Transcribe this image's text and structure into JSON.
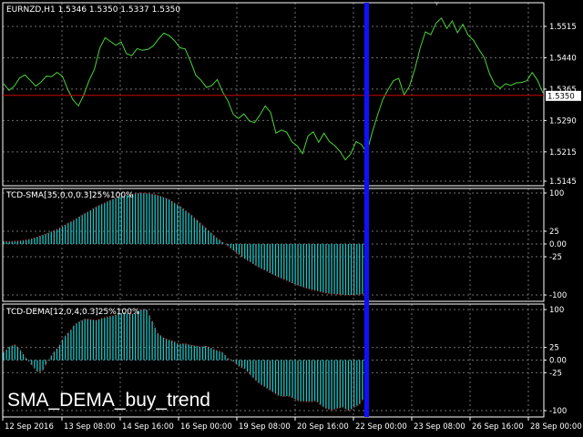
{
  "colors": {
    "background": "#000000",
    "frame": "#ffffff",
    "grid": "#6f6f6f",
    "price_line": "#4bd23a",
    "bid_line": "#c80000",
    "bid_label_bg": "#ffffff",
    "oscillator": "#1fc3c3",
    "signal_dotted": "#d01818",
    "cursor_line": "#1010ff"
  },
  "main": {
    "title": "EURNZD,H1  1.5346 1.5350 1.5337 1.5350",
    "price_labels": [
      "1.5515",
      "1.5440",
      "1.5365",
      "1.5290",
      "1.5215",
      "1.5145"
    ],
    "bid_label": "1.5350",
    "bid_value": 1.535
  },
  "sub1": {
    "title": "TCD-SMA[35,0,0,0.3]25%100%",
    "levels": [
      "100",
      "25",
      "0.00",
      "-25",
      "-100"
    ]
  },
  "sub2": {
    "title": "TCD-DEMA[12,0,4,0.3]25%100%",
    "levels": [
      "100",
      "25",
      "0.00",
      "-25",
      "-100"
    ]
  },
  "overlay_text": "SMA_DEMA_buy_trend",
  "time_labels": [
    "12 Sep 2016",
    "13 Sep 08:00",
    "14 Sep 16:00",
    "16 Sep 00:00",
    "19 Sep 08:00",
    "20 Sep 16:00",
    "22 Sep 00:00",
    "23 Sep 08:00",
    "26 Sep 16:00",
    "28 Sep 00:00"
  ],
  "chart_data": [
    {
      "type": "line",
      "series": [
        {
          "values": [
            1.5378,
            1.5362,
            1.5372,
            1.5392,
            1.5399,
            1.5386,
            1.5372,
            1.5382,
            1.5396,
            1.5395,
            1.5405,
            1.5396,
            1.5365,
            1.5339,
            1.5325,
            1.5351,
            1.5386,
            1.5412,
            1.5463,
            1.5488,
            1.5479,
            1.547,
            1.5478,
            1.545,
            1.5445,
            1.5462,
            1.5458,
            1.546,
            1.5468,
            1.5485,
            1.5499,
            1.5493,
            1.5481,
            1.5464,
            1.5461,
            1.5432,
            1.5398,
            1.5386,
            1.5369,
            1.5374,
            1.5388,
            1.5359,
            1.5337,
            1.5305,
            1.5295,
            1.5306,
            1.5289,
            1.5285,
            1.5303,
            1.5325,
            1.5309,
            1.526,
            1.5267,
            1.5262,
            1.5239,
            1.5229,
            1.5211,
            1.5253,
            1.5263,
            1.5238,
            1.526,
            1.524,
            1.523,
            1.5216,
            1.5196,
            1.521,
            1.524,
            1.5233,
            1.5213,
            1.526,
            1.5302,
            1.534,
            1.5364,
            1.5385,
            1.5391,
            1.5351,
            1.5372,
            1.5412,
            1.5463,
            1.5502,
            1.5495,
            1.5523,
            1.5535,
            1.551,
            1.5528,
            1.55,
            1.552,
            1.5494,
            1.5482,
            1.546,
            1.5441,
            1.5402,
            1.5376,
            1.5367,
            1.5378,
            1.5374,
            1.538,
            1.5381,
            1.5385,
            1.5405,
            1.5386,
            1.5356
          ]
        }
      ]
    },
    {
      "type": "bar",
      "values": [
        5,
        5,
        6,
        7,
        9,
        12,
        16,
        20,
        25,
        31,
        37,
        44,
        51,
        58,
        65,
        72,
        78,
        84,
        89,
        93,
        96,
        98,
        100,
        100,
        99,
        96,
        92,
        87,
        80,
        72,
        63,
        53,
        42,
        31,
        20,
        10,
        1,
        -8,
        -17,
        -26,
        -34,
        -41,
        -48,
        -54,
        -60,
        -66,
        -71,
        -76,
        -81,
        -85,
        -89,
        -92,
        -95,
        -97,
        -98,
        -99,
        -100,
        -100,
        -99,
        -97
      ]
    },
    {
      "type": "bar",
      "values": [
        15,
        26,
        31,
        21,
        5,
        -8,
        -22,
        -24,
        -2,
        14,
        26,
        46,
        56,
        71,
        77,
        82,
        80,
        79,
        83,
        86,
        88,
        91,
        94,
        91,
        92,
        100,
        102,
        80,
        55,
        45,
        40,
        38,
        31,
        33,
        30,
        28,
        26,
        28,
        23,
        19,
        15,
        3,
        -3,
        -13,
        -17,
        -29,
        -40,
        -49,
        -55,
        -62,
        -70,
        -72,
        -71,
        -76,
        -82,
        -82,
        -83,
        -81,
        -90,
        -97,
        -99,
        -95,
        -93,
        -101,
        -93,
        -87,
        -70
      ]
    }
  ]
}
